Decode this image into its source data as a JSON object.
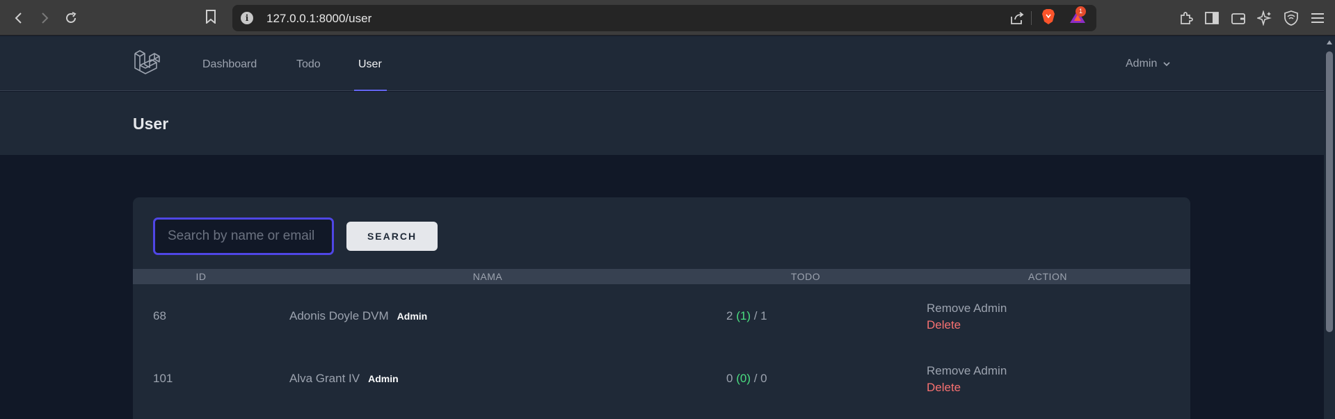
{
  "browser": {
    "url": "127.0.0.1:8000/user",
    "notification_count": "1"
  },
  "nav": {
    "links": [
      {
        "label": "Dashboard"
      },
      {
        "label": "Todo"
      },
      {
        "label": "User"
      }
    ],
    "user_menu": "Admin"
  },
  "header": {
    "title": "User"
  },
  "search": {
    "placeholder": "Search by name or email",
    "button_label": "SEARCH"
  },
  "table": {
    "columns": [
      "ID",
      "NAMA",
      "TODO",
      "ACTION"
    ],
    "rows": [
      {
        "id": "68",
        "name": "Adonis Doyle DVM",
        "role": "Admin",
        "todo_total": "2",
        "todo_done": "(1)",
        "todo_other": "1",
        "action_primary": "Remove Admin",
        "action_delete": "Delete"
      },
      {
        "id": "101",
        "name": "Alva Grant IV",
        "role": "Admin",
        "todo_total": "0",
        "todo_done": "(0)",
        "todo_other": "0",
        "action_primary": "Remove Admin",
        "action_delete": "Delete"
      }
    ]
  },
  "colors": {
    "accent": "#6366f1",
    "done": "#4ade80",
    "danger": "#f87171"
  }
}
